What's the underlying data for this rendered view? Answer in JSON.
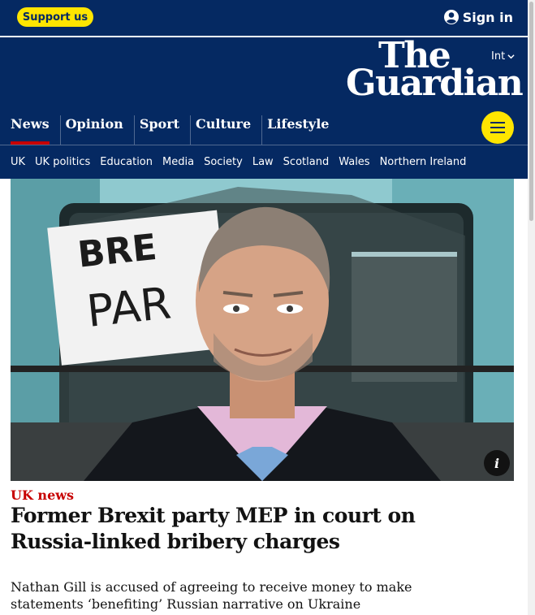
{
  "topbar": {
    "support_label": "Support us",
    "signin_label": "Sign in"
  },
  "masthead": {
    "edition": "Int",
    "logo_line1": "The",
    "logo_line2": "Guardian"
  },
  "pillars": [
    {
      "label": "News",
      "active": true
    },
    {
      "label": "Opinion"
    },
    {
      "label": "Sport"
    },
    {
      "label": "Culture"
    },
    {
      "label": "Lifestyle"
    }
  ],
  "subnav": [
    "UK",
    "UK politics",
    "Education",
    "Media",
    "Society",
    "Law",
    "Scotland",
    "Wales",
    "Northern Ireland"
  ],
  "hero": {
    "bus_sign_line1": "BRE",
    "bus_sign_line2": "PAR"
  },
  "article": {
    "kicker": "UK news",
    "headline": "Former Brexit party MEP in court on Russia-linked bribery charges",
    "standfirst": "Nathan Gill is accused of agreeing to receive money to make statements ‘benefiting’ Russian narrative on Ukraine"
  },
  "icons": {
    "signin": "user-circle-icon",
    "edition": "chevron-down-icon",
    "menu": "hamburger-menu-icon",
    "info": "info-icon"
  },
  "colors": {
    "brand_blue": "#052962",
    "support_yellow": "#ffe500",
    "news_red": "#c70000"
  }
}
